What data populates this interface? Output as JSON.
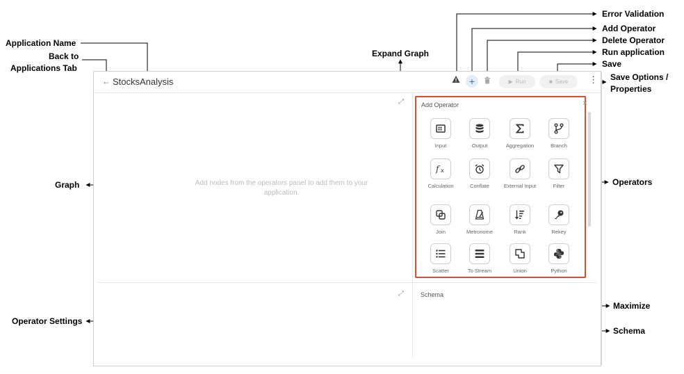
{
  "annotations": {
    "error_validation": "Error Validation",
    "add_operator": "Add Operator",
    "delete_operator": "Delete Operator",
    "run_application": "Run application",
    "save": "Save",
    "save_options_1": "Save Options /",
    "save_options_2": "Properties",
    "application_name": "Application Name",
    "back_1": "Back to",
    "back_2": "Applications Tab",
    "expand_graph": "Expand Graph",
    "graph": "Graph",
    "operators": "Operators",
    "maximize": "Maximize",
    "operator_settings": "Operator Settings",
    "schema": "Schema"
  },
  "app": {
    "back_arrow": "←",
    "name": "StocksAnalysis"
  },
  "toolbar": {
    "error_icon": "warning-icon",
    "add_icon": "plus-icon",
    "delete_icon": "trash-icon",
    "run_label": "Run",
    "save_label": "Save",
    "kebab": "⋮",
    "accent": "#1f78c8"
  },
  "graph": {
    "empty_message": "Add nodes from the operators panel to add them to your application."
  },
  "operators_panel": {
    "title": "Add Operator",
    "close": "×",
    "border_color": "#e4492a",
    "items": [
      {
        "label": "Input",
        "icon": "input-icon"
      },
      {
        "label": "Output",
        "icon": "database-icon"
      },
      {
        "label": "Aggregation",
        "icon": "sigma-icon"
      },
      {
        "label": "Branch",
        "icon": "branch-icon"
      },
      {
        "label": "Calculation",
        "icon": "function-icon"
      },
      {
        "label": "Conflate",
        "icon": "alarm-clock-icon"
      },
      {
        "label": "External Input",
        "icon": "link-icon"
      },
      {
        "label": "Filter",
        "icon": "filter-icon"
      },
      {
        "label": "Join",
        "icon": "join-icon"
      },
      {
        "label": "Metronome",
        "icon": "metronome-icon"
      },
      {
        "label": "Rank",
        "icon": "sort-icon"
      },
      {
        "label": "Rekey",
        "icon": "key-icon"
      },
      {
        "label": "Scatter",
        "icon": "list-icon"
      },
      {
        "label": "To Stream",
        "icon": "bars-icon"
      },
      {
        "label": "Union",
        "icon": "union-icon"
      },
      {
        "label": "Python",
        "icon": "python-icon"
      }
    ]
  },
  "schema": {
    "title": "Schema"
  }
}
